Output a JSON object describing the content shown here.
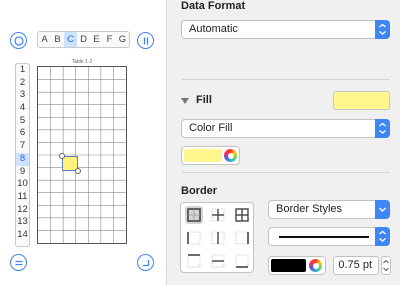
{
  "preview": {
    "column_headers": [
      "A",
      "B",
      "C",
      "D",
      "E",
      "F",
      "G"
    ],
    "selected_column": "C",
    "row_headers": [
      "1",
      "2",
      "3",
      "4",
      "5",
      "6",
      "7",
      "8",
      "9",
      "10",
      "11",
      "12",
      "13",
      "14"
    ],
    "selected_row": "8",
    "table_title": "Table 1-2",
    "selected_cell_fill": "#fff37a"
  },
  "inspector": {
    "data_format_label": "Data Format",
    "data_format_value": "Automatic",
    "fill_label": "Fill",
    "fill_color": "#fff68e",
    "fill_type_value": "Color Fill",
    "border_label": "Border",
    "border_styles_value": "Border Styles",
    "stroke_color": "#000000",
    "stroke_width_value": "0.75 pt",
    "accent_color": "#3f86f5"
  }
}
